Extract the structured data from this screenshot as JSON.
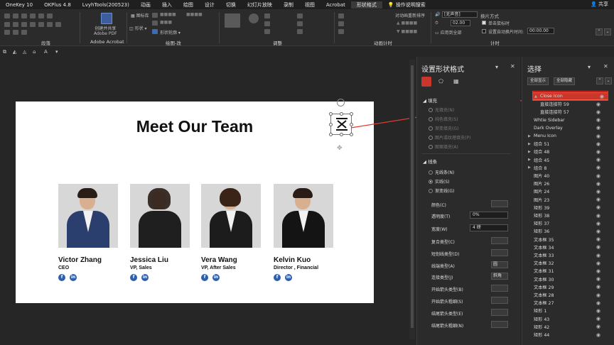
{
  "menu": {
    "tabs": [
      "OneKey 10",
      "OKPlus 4.8",
      "LvyhTools(200523)",
      "动画",
      "插入",
      "绘图",
      "设计",
      "切换",
      "幻灯片放映",
      "录制",
      "视图",
      "Acrobat",
      "形状格式"
    ],
    "active_tab": "形状格式",
    "search_label": "操作说明搜索",
    "share_label": "共享"
  },
  "ribbon": {
    "groups": [
      "段落",
      "Adobe Acrobat",
      "绘图-改",
      "调整",
      "动画计时",
      "计时"
    ],
    "acrobat_button": "创建并共享\nAdobe PDF",
    "shape_button": "形状",
    "shape_outline": "形状轮廓",
    "gif_label": "图标库",
    "timing": {
      "sound_value": "[无声音]",
      "duration_value": "02.00",
      "apply_all_label": "应用到全部",
      "advance_label": "换片方式",
      "on_click_label": "单击鼠标时",
      "after_label": "设置自动换片时间:",
      "after_value": "00:00.00",
      "reorder_label": "对动画重新排序"
    }
  },
  "slide": {
    "title": "Meet Our Team",
    "members": [
      {
        "name": "Victor Zhang",
        "role": "CEO",
        "suit": "#2a3f6e"
      },
      {
        "name": "Jessica Liu",
        "role": "VP, Sales",
        "suit": "#1f1f1f"
      },
      {
        "name": "Vera Wang",
        "role": "VP, After Sales",
        "suit": "#1c1c1c"
      },
      {
        "name": "Kelvin Kuo",
        "role": "Director , Financial",
        "suit": "#141414"
      }
    ],
    "social": {
      "facebook": "f",
      "linkedin": "in"
    }
  },
  "format_pane": {
    "title": "设置形状格式",
    "fill_section": "填充",
    "fill_options": [
      "无填充(N)",
      "纯色填充(S)",
      "渐变填充(G)",
      "图片或纹理填充(P)",
      "图案填充(A)"
    ],
    "line_section": "线条",
    "line_options": [
      "无线条(N)",
      "实线(S)",
      "渐变线(G)"
    ],
    "line_selected": "实线(S)",
    "props": [
      {
        "label": "颜色(C)",
        "value": ""
      },
      {
        "label": "透明度(T)",
        "value": "0%"
      },
      {
        "label": "宽度(W)",
        "value": "4 磅"
      },
      {
        "label": "复合类型(C)",
        "value": ""
      },
      {
        "label": "短划线类型(D)",
        "value": ""
      },
      {
        "label": "线端类型(A)",
        "value": "圆"
      },
      {
        "label": "连接类型(J)",
        "value": "斜角"
      },
      {
        "label": "开始箭头类型(B)",
        "value": ""
      },
      {
        "label": "开始箭头粗细(S)",
        "value": ""
      },
      {
        "label": "结尾箭头类型(E)",
        "value": ""
      },
      {
        "label": "结尾箭头粗细(N)",
        "value": ""
      }
    ]
  },
  "selection_pane": {
    "title": "选择",
    "show_all": "全部显示",
    "hide_all": "全部隐藏",
    "items": [
      {
        "label": "Close Icon",
        "expand": "▲",
        "indent": 0,
        "selected": true
      },
      {
        "label": "直接连接符 59",
        "expand": "",
        "indent": 1
      },
      {
        "label": "直接连接符 57",
        "expand": "",
        "indent": 1
      },
      {
        "label": "Whtie Sidebar",
        "expand": "",
        "indent": 0
      },
      {
        "label": "Dark Overlay",
        "expand": "",
        "indent": 0
      },
      {
        "label": "Menu Icon",
        "expand": "▶",
        "indent": 0
      },
      {
        "label": "组合 51",
        "expand": "▶",
        "indent": 0
      },
      {
        "label": "组合 48",
        "expand": "▶",
        "indent": 0
      },
      {
        "label": "组合 45",
        "expand": "▶",
        "indent": 0
      },
      {
        "label": "组合 8",
        "expand": "▶",
        "indent": 0
      },
      {
        "label": "图片 40",
        "expand": "",
        "indent": 0
      },
      {
        "label": "图片 26",
        "expand": "",
        "indent": 0
      },
      {
        "label": "图片 24",
        "expand": "",
        "indent": 0
      },
      {
        "label": "图片 23",
        "expand": "",
        "indent": 0
      },
      {
        "label": "矩形 39",
        "expand": "",
        "indent": 0
      },
      {
        "label": "矩形 38",
        "expand": "",
        "indent": 0
      },
      {
        "label": "矩形 37",
        "expand": "",
        "indent": 0
      },
      {
        "label": "矩形 36",
        "expand": "",
        "indent": 0
      },
      {
        "label": "文本框 35",
        "expand": "",
        "indent": 0
      },
      {
        "label": "文本框 34",
        "expand": "",
        "indent": 0
      },
      {
        "label": "文本框 33",
        "expand": "",
        "indent": 0
      },
      {
        "label": "文本框 32",
        "expand": "",
        "indent": 0
      },
      {
        "label": "文本框 31",
        "expand": "",
        "indent": 0
      },
      {
        "label": "文本框 30",
        "expand": "",
        "indent": 0
      },
      {
        "label": "文本框 29",
        "expand": "",
        "indent": 0
      },
      {
        "label": "文本框 28",
        "expand": "",
        "indent": 0
      },
      {
        "label": "文本框 27",
        "expand": "",
        "indent": 0
      },
      {
        "label": "矩形 1",
        "expand": "",
        "indent": 0
      },
      {
        "label": "矩形 43",
        "expand": "",
        "indent": 0
      },
      {
        "label": "矩形 42",
        "expand": "",
        "indent": 0
      },
      {
        "label": "矩形 44",
        "expand": "",
        "indent": 0
      }
    ]
  },
  "colors": {
    "accent_red": "#e03a2e",
    "selected_row": "#c8372a",
    "social_blue": "#2d5faa"
  }
}
